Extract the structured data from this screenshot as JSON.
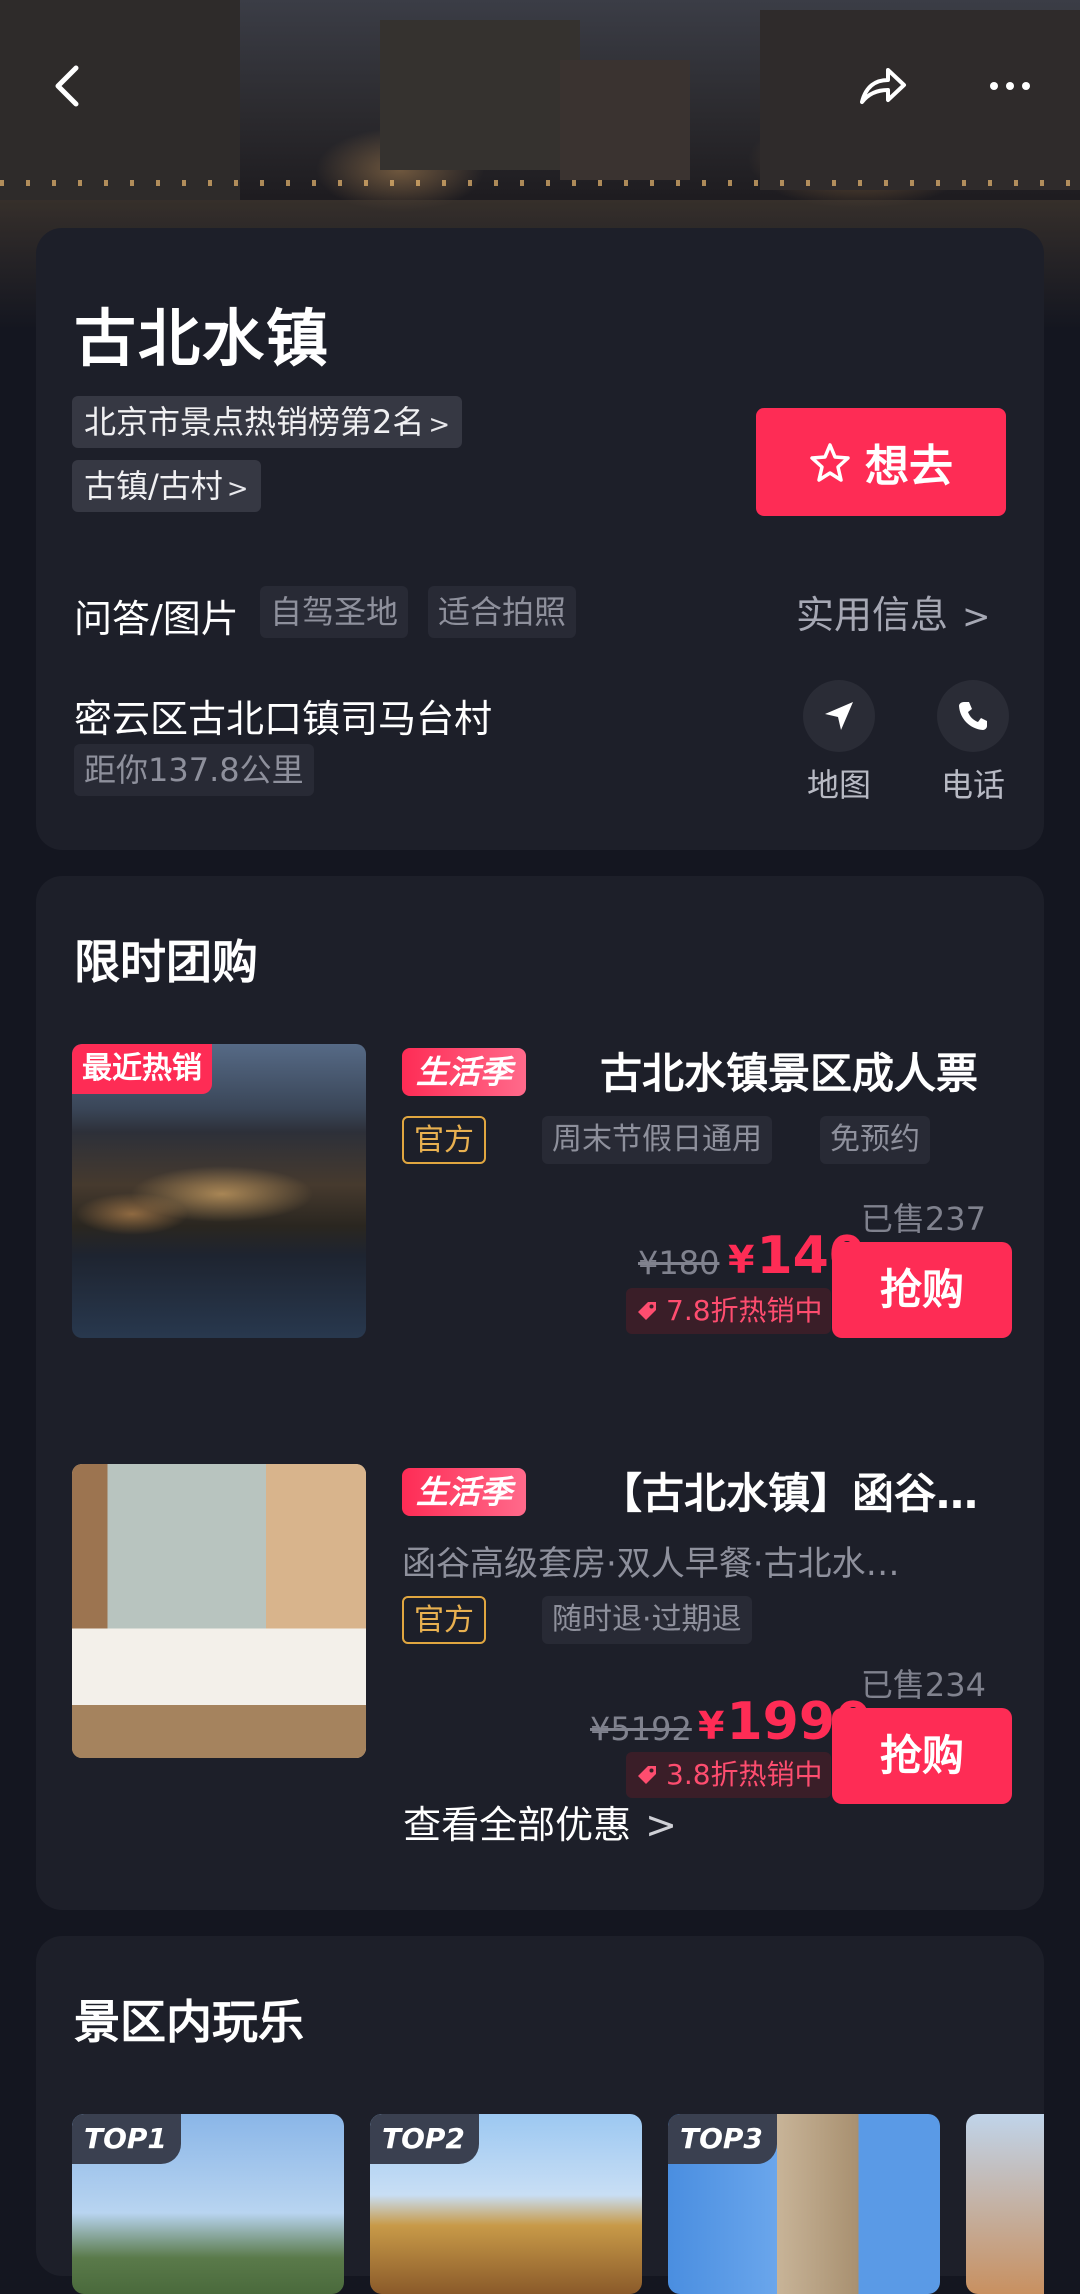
{
  "header": {
    "back_icon": "chevron-left-icon",
    "share_icon": "share-arrow-icon",
    "more_icon": "more-dots-icon"
  },
  "info": {
    "title": "古北水镇",
    "ranking_chip": "北京市景点热销榜第2名",
    "category_chip": "古镇/古村",
    "want_label": "想去",
    "qa_label": "问答/图片",
    "tags": [
      "自驾圣地",
      "适合拍照"
    ],
    "useful_info": "实用信息",
    "address": "密云区古北口镇司马台村",
    "distance": "距你137.8公里",
    "map_label": "地图",
    "phone_label": "电话"
  },
  "deals": {
    "section_title": "限时团购",
    "items": [
      {
        "badge": "最近热销",
        "season": "生活季",
        "name": "古北水镇景区成人票",
        "subtitle": "",
        "official": "官方",
        "tags": [
          "周末节假日通用",
          "免预约"
        ],
        "sold": "已售237",
        "original_price": "¥180",
        "currency": "¥",
        "price": "140",
        "discount": "7.8折热销中",
        "buy": "抢购"
      },
      {
        "badge": "",
        "season": "生活季",
        "name": "【古北水镇】函谷…",
        "subtitle": "函谷高级套房·双人早餐·古北水…",
        "official": "官方",
        "tags": [
          "随时退·过期退"
        ],
        "sold": "已售234",
        "original_price": "¥5192",
        "currency": "¥",
        "price": "1990",
        "discount": "3.8折热销中",
        "buy": "抢购"
      }
    ],
    "view_all": "查看全部优惠"
  },
  "play": {
    "section_title": "景区内玩乐",
    "cards": [
      {
        "badge": "TOP1"
      },
      {
        "badge": "TOP2"
      },
      {
        "badge": "TOP3"
      }
    ]
  },
  "colors": {
    "accent": "#fe2c55",
    "background": "#141620",
    "card": "#1d1f29",
    "official": "#e0a640"
  }
}
